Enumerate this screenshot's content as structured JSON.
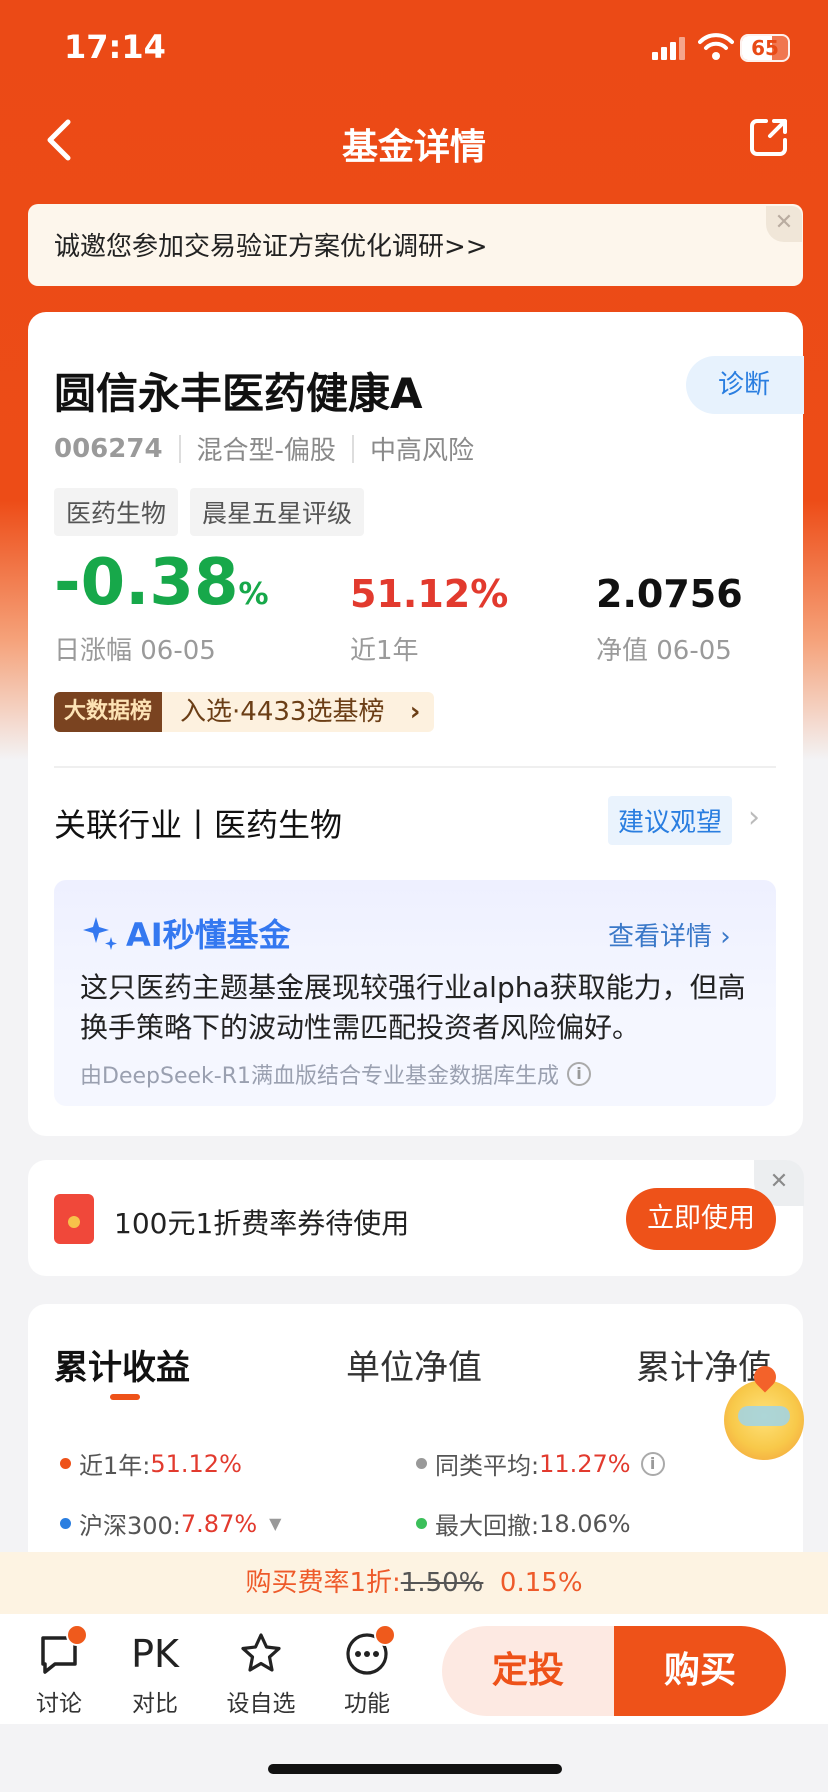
{
  "status_bar": {
    "time": "17:14",
    "battery": "65"
  },
  "nav": {
    "title": "基金详情"
  },
  "survey_banner": {
    "text": "诚邀您参加交易验证方案优化调研>>"
  },
  "fund": {
    "name": "圆信永丰医药健康A",
    "diagnose_label": "诊断",
    "code": "006274",
    "type": "混合型-偏股",
    "risk": "中高风险",
    "tags": [
      "医药生物",
      "晨星五星评级"
    ]
  },
  "stats": {
    "daily_change": "-0.38",
    "daily_change_unit": "%",
    "daily_label": "日涨幅 06-05",
    "one_year": "51.12%",
    "one_year_label": "近1年",
    "nav": "2.0756",
    "nav_label": "净值 06-05"
  },
  "ranking": {
    "badge": "大数据榜",
    "text": "入选·4433选基榜"
  },
  "industry": {
    "text": "关联行业丨医药生物",
    "advice": "建议观望"
  },
  "ai": {
    "title": "AI秒懂基金",
    "more": "查看详情",
    "body": "这只医药主题基金展现较强行业alpha获取能力，但高换手策略下的波动性需匹配投资者风险偏好。",
    "footnote": "由DeepSeek-R1满血版结合专业基金数据库生成"
  },
  "coupon": {
    "text": "100元1折费率券待使用",
    "button": "立即使用"
  },
  "chart_tabs": [
    "累计收益",
    "单位净值",
    "累计净值"
  ],
  "legend": {
    "one_year_label": "近1年: ",
    "one_year_value": "51.12%",
    "peer_label": "同类平均: ",
    "peer_value": "11.27%",
    "hs300_label": "沪深300: ",
    "hs300_value": "7.87%",
    "drawdown_label": "最大回撤: ",
    "drawdown_value": "18.06%"
  },
  "colors": {
    "orange": "#ee5219",
    "red": "#e23a2e",
    "green": "#17a84a",
    "blue": "#2a7ee0"
  },
  "fee_bar": {
    "prefix": "购买费率1折:",
    "old": "1.50%",
    "new": "0.15%"
  },
  "bottom_nav": {
    "items": [
      "讨论",
      "对比",
      "设自选",
      "功能"
    ],
    "pk_text": "PK",
    "dingtou": "定投",
    "buy": "购买"
  }
}
